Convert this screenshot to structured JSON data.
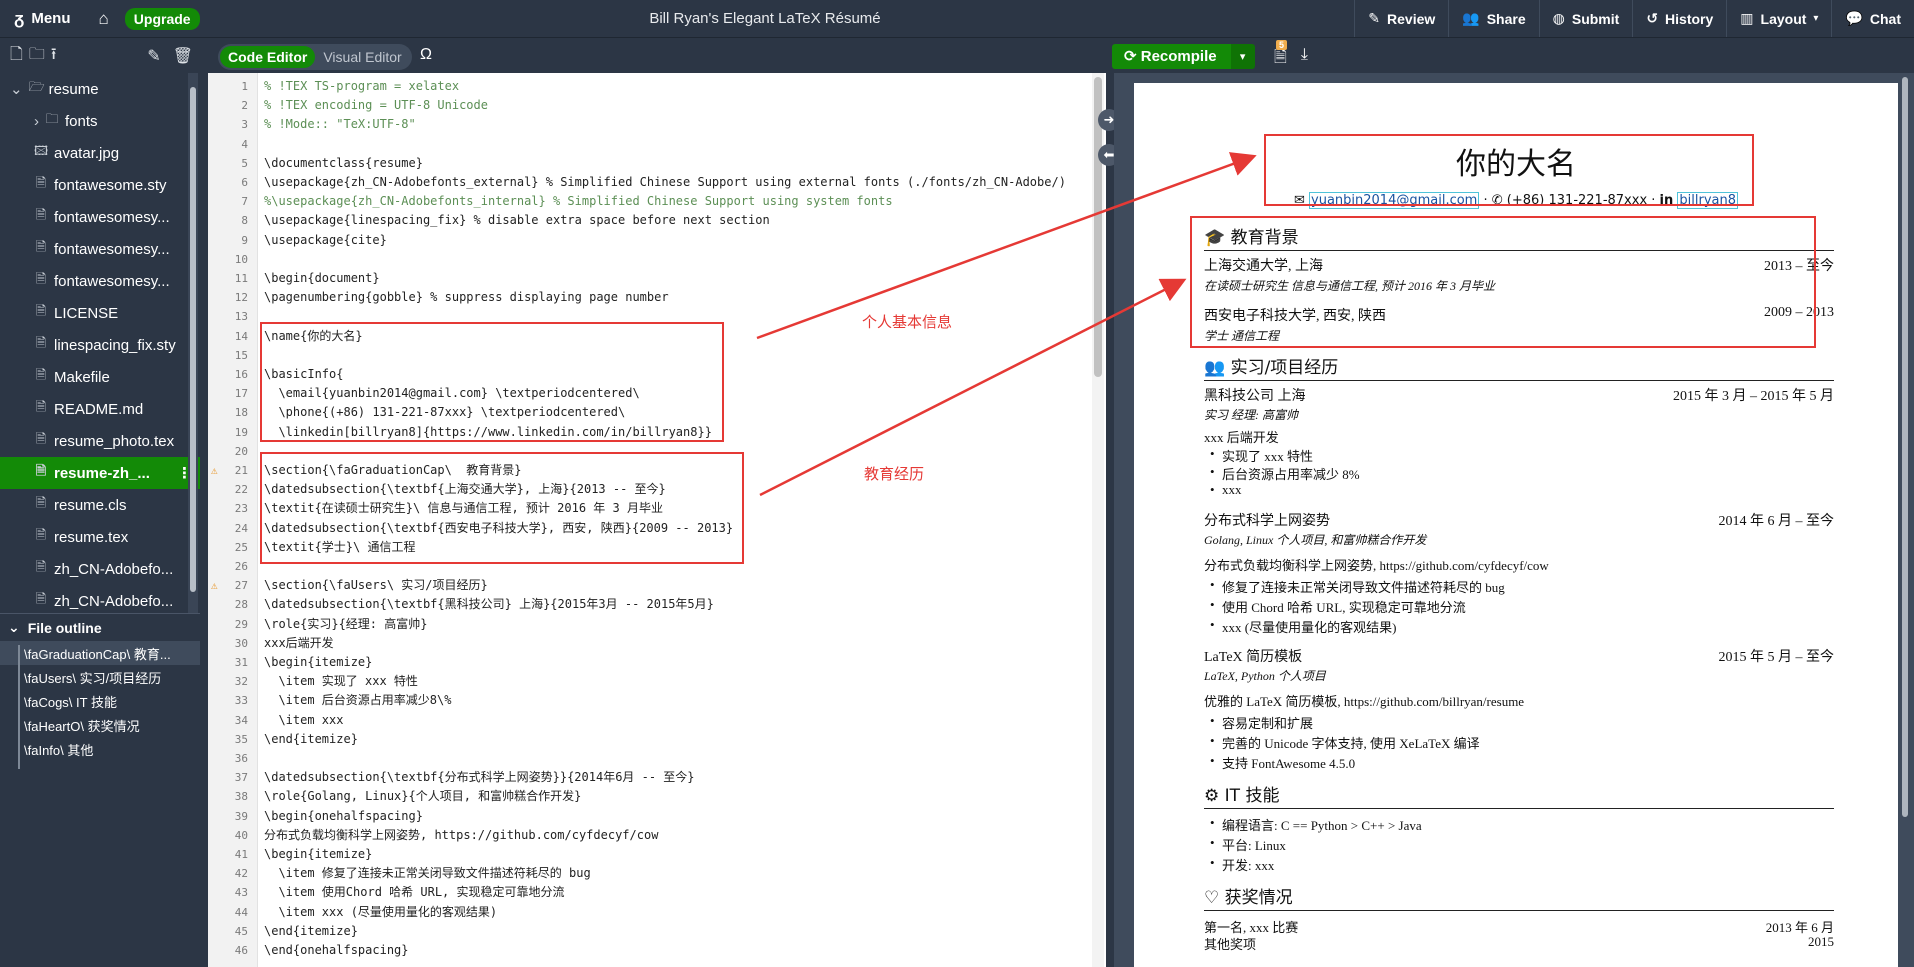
{
  "topbar": {
    "menu": "Menu",
    "upgrade": "Upgrade",
    "title": "Bill Ryan's Elegant LaTeX Résumé",
    "actions": [
      "Review",
      "Share",
      "Submit",
      "History",
      "Layout",
      "Chat"
    ]
  },
  "toolbar": {
    "code_editor": "Code Editor",
    "visual_editor": "Visual Editor",
    "omega": "Ω",
    "recompile": "Recompile",
    "warnings": "5"
  },
  "filetree": {
    "items": [
      {
        "label": "resume",
        "type": "folder-open"
      },
      {
        "label": "fonts",
        "type": "folder"
      },
      {
        "label": "avatar.jpg",
        "type": "image"
      },
      {
        "label": "fontawesome.sty",
        "type": "file"
      },
      {
        "label": "fontawesomesy...",
        "type": "file"
      },
      {
        "label": "fontawesomesy...",
        "type": "file"
      },
      {
        "label": "fontawesomesy...",
        "type": "file"
      },
      {
        "label": "LICENSE",
        "type": "file"
      },
      {
        "label": "linespacing_fix.sty",
        "type": "file"
      },
      {
        "label": "Makefile",
        "type": "file"
      },
      {
        "label": "README.md",
        "type": "file"
      },
      {
        "label": "resume_photo.tex",
        "type": "file"
      },
      {
        "label": "resume-zh_...",
        "type": "file"
      },
      {
        "label": "resume.cls",
        "type": "file"
      },
      {
        "label": "resume.tex",
        "type": "file"
      },
      {
        "label": "zh_CN-Adobefo...",
        "type": "file"
      },
      {
        "label": "zh_CN-Adobefo...",
        "type": "file"
      }
    ]
  },
  "outline": {
    "title": "File outline",
    "items": [
      "\\faGraduationCap\\ 教育...",
      "\\faUsers\\ 实习/项目经历",
      "\\faCogs\\ IT 技能",
      "\\faHeartO\\ 获奖情况",
      "\\faInfo\\ 其他"
    ]
  },
  "editor": {
    "lines": [
      {
        "n": "1",
        "t": "% !TEX TS-program = xelatex"
      },
      {
        "n": "2",
        "t": "% !TEX encoding = UTF-8 Unicode"
      },
      {
        "n": "3",
        "t": "% !Mode:: \"TeX:UTF-8\""
      },
      {
        "n": "4",
        "t": ""
      },
      {
        "n": "5",
        "t": "\\documentclass{resume}"
      },
      {
        "n": "6",
        "t": "\\usepackage{zh_CN-Adobefonts_external} % Simplified Chinese Support using external fonts (./fonts/zh_CN-Adobe/)"
      },
      {
        "n": "7",
        "t": "%\\usepackage{zh_CN-Adobefonts_internal} % Simplified Chinese Support using system fonts"
      },
      {
        "n": "8",
        "t": "\\usepackage{linespacing_fix} % disable extra space before next section"
      },
      {
        "n": "9",
        "t": "\\usepackage{cite}"
      },
      {
        "n": "10",
        "t": ""
      },
      {
        "n": "11",
        "t": "\\begin{document}"
      },
      {
        "n": "12",
        "t": "\\pagenumbering{gobble} % suppress displaying page number"
      },
      {
        "n": "13",
        "t": ""
      },
      {
        "n": "14",
        "t": "\\name{你的大名}"
      },
      {
        "n": "15",
        "t": ""
      },
      {
        "n": "16",
        "t": "\\basicInfo{"
      },
      {
        "n": "17",
        "t": "  \\email{yuanbin2014@gmail.com} \\textperiodcentered\\"
      },
      {
        "n": "18",
        "t": "  \\phone{(+86) 131-221-87xxx} \\textperiodcentered\\"
      },
      {
        "n": "19",
        "t": "  \\linkedin[billryan8]{https://www.linkedin.com/in/billryan8}}"
      },
      {
        "n": "20",
        "t": ""
      },
      {
        "n": "21",
        "t": "\\section{\\faGraduationCap\\  教育背景}"
      },
      {
        "n": "22",
        "t": "\\datedsubsection{\\textbf{上海交通大学}, 上海}{2013 -- 至今}"
      },
      {
        "n": "23",
        "t": "\\textit{在读硕士研究生}\\ 信息与通信工程, 预计 2016 年 3 月毕业"
      },
      {
        "n": "24",
        "t": "\\datedsubsection{\\textbf{西安电子科技大学}, 西安, 陕西}{2009 -- 2013}"
      },
      {
        "n": "25",
        "t": "\\textit{学士}\\ 通信工程"
      },
      {
        "n": "26",
        "t": ""
      },
      {
        "n": "27",
        "t": "\\section{\\faUsers\\ 实习/项目经历}"
      },
      {
        "n": "28",
        "t": "\\datedsubsection{\\textbf{黑科技公司} 上海}{2015年3月 -- 2015年5月}"
      },
      {
        "n": "29",
        "t": "\\role{实习}{经理: 高富帅}"
      },
      {
        "n": "30",
        "t": "xxx后端开发"
      },
      {
        "n": "31",
        "t": "\\begin{itemize}"
      },
      {
        "n": "32",
        "t": "  \\item 实现了 xxx 特性"
      },
      {
        "n": "33",
        "t": "  \\item 后台资源占用率减少8\\%"
      },
      {
        "n": "34",
        "t": "  \\item xxx"
      },
      {
        "n": "35",
        "t": "\\end{itemize}"
      },
      {
        "n": "36",
        "t": ""
      },
      {
        "n": "37",
        "t": "\\datedsubsection{\\textbf{分布式科学上网姿势}}{2014年6月 -- 至今}"
      },
      {
        "n": "38",
        "t": "\\role{Golang, Linux}{个人项目, 和富帅糕合作开发}"
      },
      {
        "n": "39",
        "t": "\\begin{onehalfspacing}"
      },
      {
        "n": "40",
        "t": "分布式负载均衡科学上网姿势, https://github.com/cyfdecyf/cow"
      },
      {
        "n": "41",
        "t": "\\begin{itemize}"
      },
      {
        "n": "42",
        "t": "  \\item 修复了连接未正常关闭导致文件描述符耗尽的 bug"
      },
      {
        "n": "43",
        "t": "  \\item 使用Chord 哈希 URL, 实现稳定可靠地分流"
      },
      {
        "n": "44",
        "t": "  \\item xxx (尽量使用量化的客观结果)"
      },
      {
        "n": "45",
        "t": "\\end{itemize}"
      },
      {
        "n": "46",
        "t": "\\end{onehalfspacing}"
      }
    ]
  },
  "annotations": {
    "basic_info": "个人基本信息",
    "education": "教育经历"
  },
  "resume": {
    "name": "你的大名",
    "email": "yuanbin2014@gmail.com",
    "phone": "(+86) 131-221-87xxx",
    "linkedin": "billryan8",
    "sec_edu": "教育背景",
    "edu1": "上海交通大学, 上海",
    "edu1_date": "2013 – 至今",
    "edu1_detail": "在读硕士研究生 信息与通信工程, 预计 2016 年 3 月毕业",
    "edu2": "西安电子科技大学, 西安, 陕西",
    "edu2_date": "2009 – 2013",
    "edu2_detail": "学士 通信工程",
    "sec_exp": "实习/项目经历",
    "job1": "黑科技公司 上海",
    "job1_date": "2015 年 3 月 – 2015 年 5 月",
    "job1_role": "实习  经理: 高富帅",
    "job1_desc": "xxx 后端开发",
    "job1_b1": "实现了 xxx 特性",
    "job1_b2": "后台资源占用率减少 8%",
    "job1_b3": "xxx",
    "job2": "分布式科学上网姿势",
    "job2_date": "2014 年 6 月 – 至今",
    "job2_role": "Golang, Linux  个人项目, 和富帅糕合作开发",
    "job2_desc": "分布式负载均衡科学上网姿势, https://github.com/cyfdecyf/cow",
    "job2_b1": "修复了连接未正常关闭导致文件描述符耗尽的 bug",
    "job2_b2": "使用 Chord 哈希 URL, 实现稳定可靠地分流",
    "job2_b3": "xxx (尽量使用量化的客观结果)",
    "job3": "LaTeX 简历模板",
    "job3_date": "2015 年 5 月 – 至今",
    "job3_role": "LaTeX, Python  个人项目",
    "job3_desc": "优雅的 LaTeX 简历模板, https://github.com/billryan/resume",
    "job3_b1": "容易定制和扩展",
    "job3_b2": "完善的 Unicode 字体支持, 使用 XeLaTeX 编译",
    "job3_b3": "支持 FontAwesome 4.5.0",
    "sec_it": "IT 技能",
    "it1": "编程语言: C == Python > C++ > Java",
    "it2": "平台: Linux",
    "it3": "开发: xxx",
    "sec_award": "获奖情况",
    "award1": "第一名, xxx 比赛",
    "award1_date": "2013 年 6 月",
    "award2": "其他奖项",
    "award2_date": "2015"
  }
}
